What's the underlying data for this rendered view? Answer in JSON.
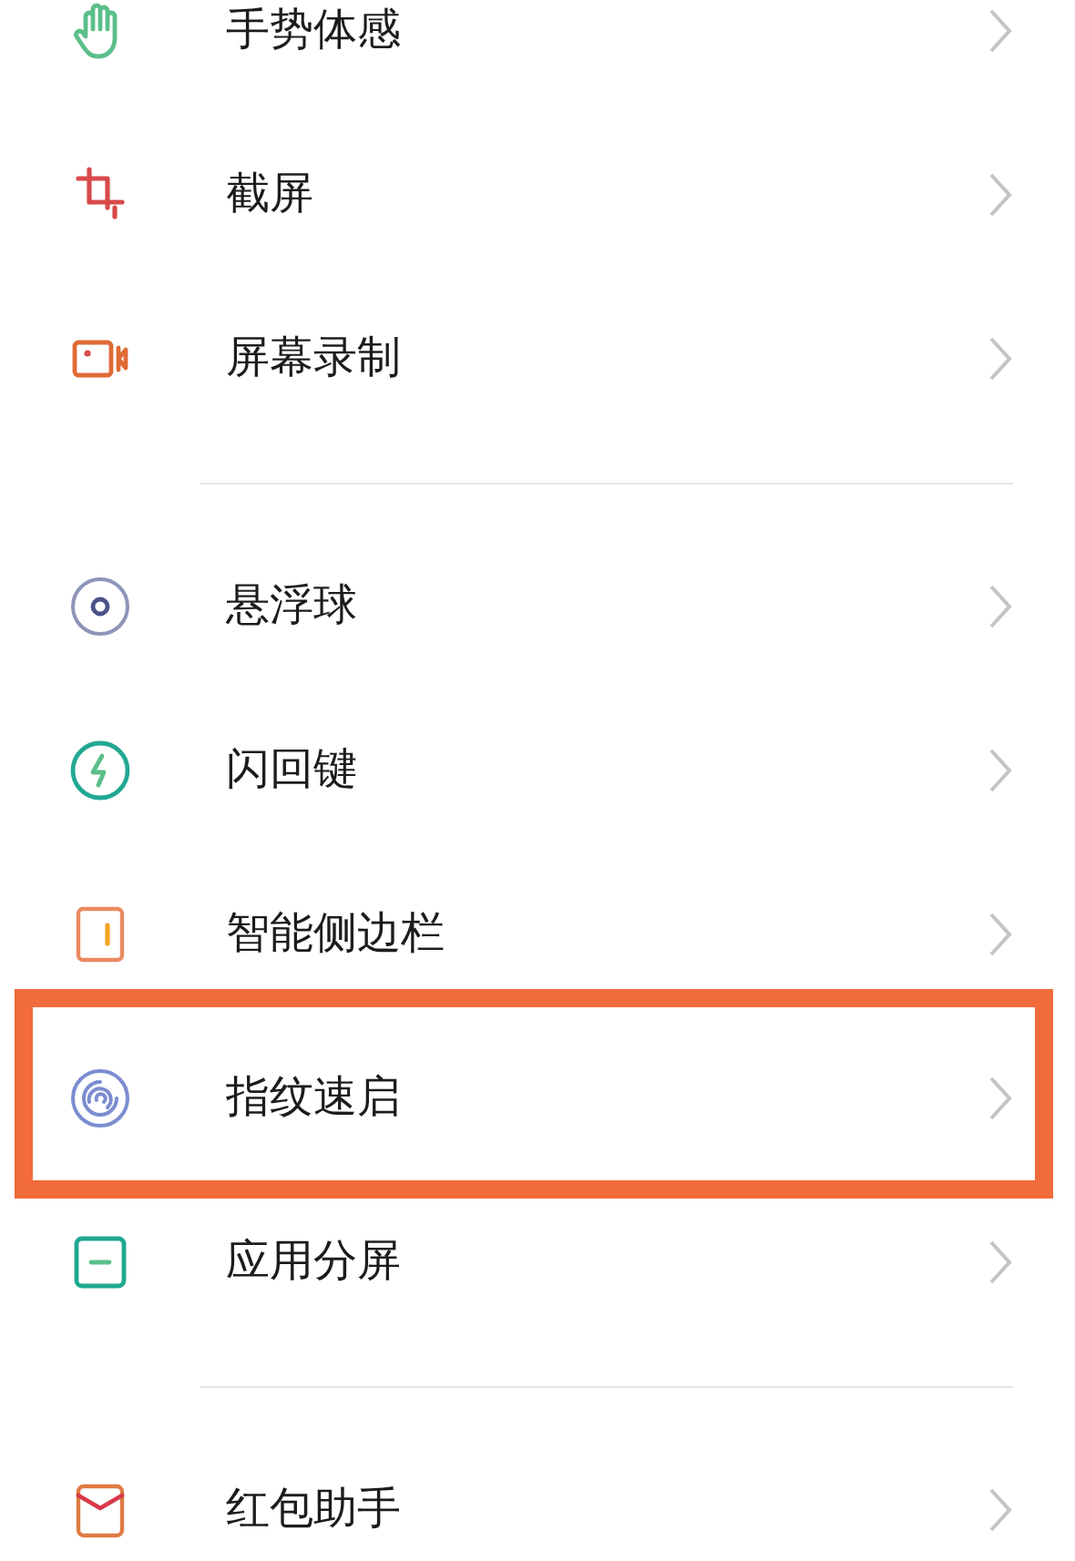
{
  "groups": [
    {
      "items": [
        {
          "label": "手势体感",
          "highlighted": false
        },
        {
          "label": "截屏",
          "highlighted": false
        },
        {
          "label": "屏幕录制",
          "highlighted": false
        }
      ]
    },
    {
      "items": [
        {
          "label": "悬浮球",
          "highlighted": false
        },
        {
          "label": "闪回键",
          "highlighted": false
        },
        {
          "label": "智能侧边栏",
          "highlighted": false
        },
        {
          "label": "指纹速启",
          "highlighted": true
        },
        {
          "label": "应用分屏",
          "highlighted": false
        }
      ]
    },
    {
      "items": [
        {
          "label": "红包助手",
          "highlighted": false
        }
      ]
    }
  ]
}
